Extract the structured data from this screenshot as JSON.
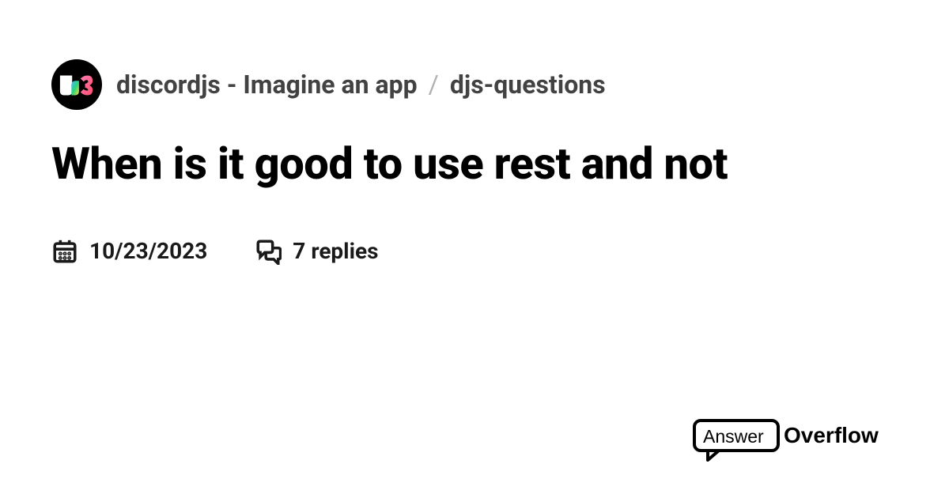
{
  "breadcrumb": {
    "server": "discordjs - Imagine an app",
    "channel": "djs-questions",
    "separator": "/"
  },
  "title": "When is it good to use rest and not",
  "meta": {
    "date": "10/23/2023",
    "replies": "7 replies"
  },
  "brand": {
    "word1": "Answer",
    "word2": "Overflow"
  }
}
